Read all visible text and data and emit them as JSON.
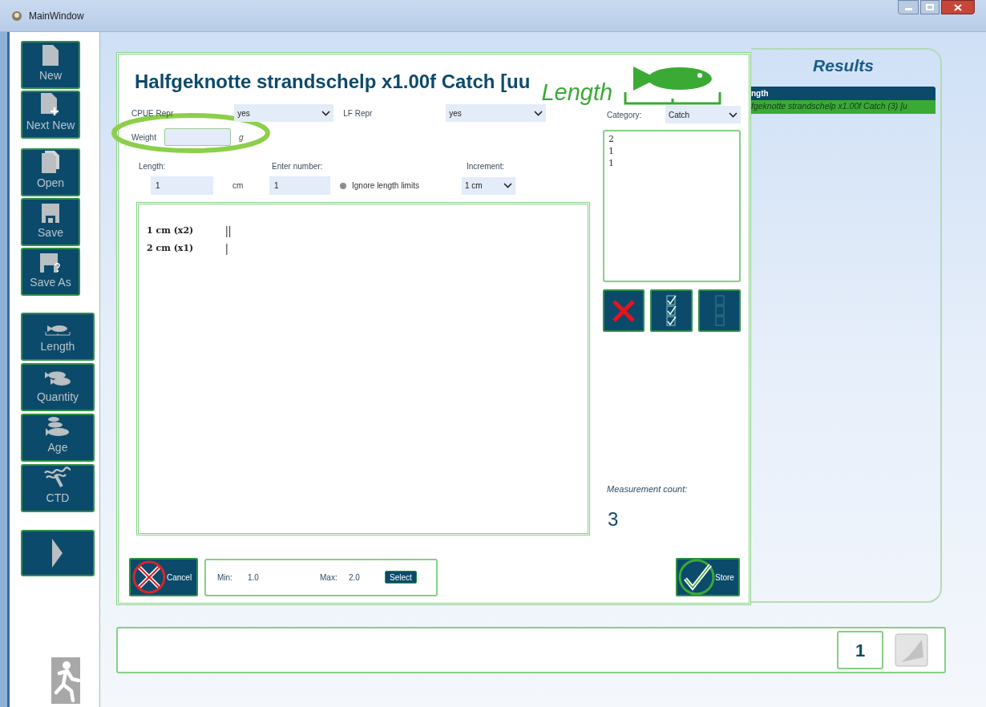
{
  "window": {
    "title": "MainWindow"
  },
  "sidebar": {
    "file_buttons": [
      {
        "label": "New"
      },
      {
        "label": "Next New"
      },
      {
        "label": "Open"
      },
      {
        "label": "Save"
      },
      {
        "label": "Save As"
      }
    ],
    "view_buttons": [
      {
        "label": "Length"
      },
      {
        "label": "Quantity"
      },
      {
        "label": "Age"
      },
      {
        "label": "CTD"
      }
    ]
  },
  "dialog": {
    "title": "Halfgeknotte strandschelp x1.00f Catch [uu",
    "mode_label": "Length",
    "cpue_repr": {
      "label": "CPUE Repr",
      "value": "yes"
    },
    "lf_repr": {
      "label": "LF Repr",
      "value": "yes"
    },
    "weight": {
      "label": "Weight",
      "unit": "g"
    },
    "length": {
      "label": "Length:",
      "value": "1",
      "unit": "cm"
    },
    "enter_number": {
      "label": "Enter number:",
      "value": "1"
    },
    "ignore_length_limits": {
      "label": "Ignore length limits",
      "checked": false
    },
    "increment": {
      "label": "Increment:",
      "value": "1 cm"
    },
    "measurements": [
      {
        "label": "1 cm (x2)",
        "tally": "||"
      },
      {
        "label": "2 cm (x1)",
        "tally": "|"
      }
    ],
    "category": {
      "label": "Category:",
      "value": "Catch"
    },
    "entries": [
      "2",
      "1",
      "1"
    ],
    "measurement_count": {
      "label": "Measurement count:",
      "value": "3"
    },
    "cancel": "Cancel",
    "range": {
      "min_label": "Min:",
      "min": "1.0",
      "max_label": "Max:",
      "max": "2.0",
      "select": "Select"
    },
    "store": "Store"
  },
  "results": {
    "title": "Results",
    "header": "ngth",
    "rows": [
      {
        "text": "fgeknotte strandschelp x1.00f Catch (3) [u",
        "selected": true
      }
    ]
  },
  "status_bar": {
    "page": "1"
  }
}
